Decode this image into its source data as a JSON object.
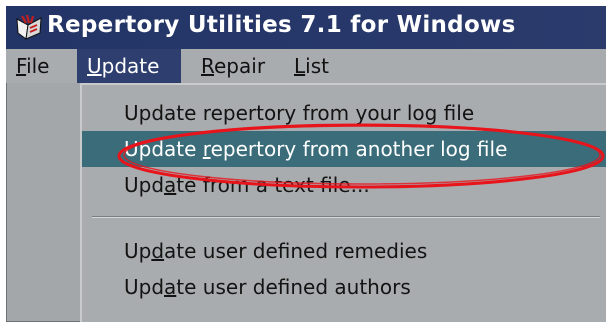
{
  "window": {
    "title": "Repertory Utilities 7.1 for Windows",
    "logo_icon": "repertory-logo-icon"
  },
  "menubar": {
    "items": [
      {
        "before": "",
        "mnemonic": "F",
        "after": "ile"
      },
      {
        "before": "",
        "mnemonic": "U",
        "after": "pdate"
      },
      {
        "before": "",
        "mnemonic": "R",
        "after": "epair"
      },
      {
        "before": "",
        "mnemonic": "L",
        "after": "ist"
      }
    ],
    "active": "Update"
  },
  "dropdown": {
    "items": [
      {
        "before": "Update repertory from your log file",
        "mnemonic": "",
        "after": ""
      },
      {
        "before": "Update ",
        "mnemonic": "r",
        "after": "epertory from another log file"
      },
      {
        "before": "Upd",
        "mnemonic": "a",
        "after": "te from a text file..."
      },
      {
        "before": "Up",
        "mnemonic": "d",
        "after": "ate user defined remedies"
      },
      {
        "before": "Upd",
        "mnemonic": "a",
        "after": "te user defined authors"
      }
    ],
    "highlighted_index": 1
  },
  "colors": {
    "titlebar": "#233466",
    "menu_active": "#2e3f6f",
    "item_highlight": "#3a6c7a",
    "annotation_ellipse": "#e8141c"
  }
}
